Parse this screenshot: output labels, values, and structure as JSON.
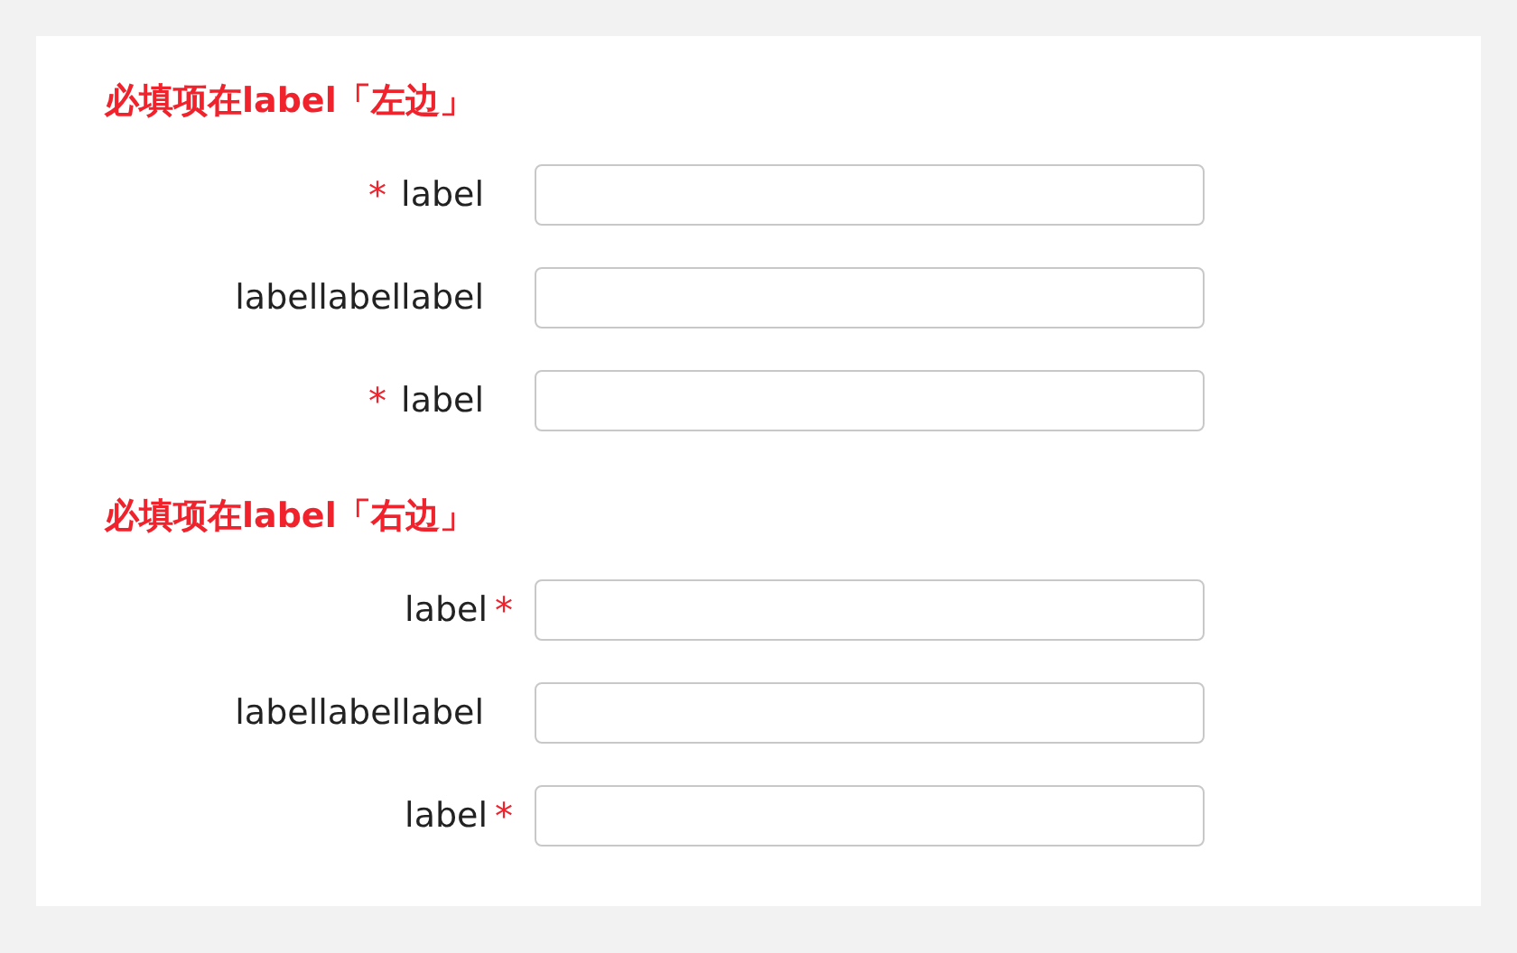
{
  "sections": [
    {
      "title": "必填项在label「左边」",
      "fields": [
        {
          "label": "label",
          "mark_before": "*"
        },
        {
          "label": "labellabellabel"
        },
        {
          "label": "label",
          "mark_before": "*"
        }
      ]
    },
    {
      "title": "必填项在label「右边」",
      "fields": [
        {
          "label": "label",
          "mark_after": "*"
        },
        {
          "label": "labellabellabel"
        },
        {
          "label": "label",
          "mark_after": "*"
        }
      ]
    }
  ]
}
